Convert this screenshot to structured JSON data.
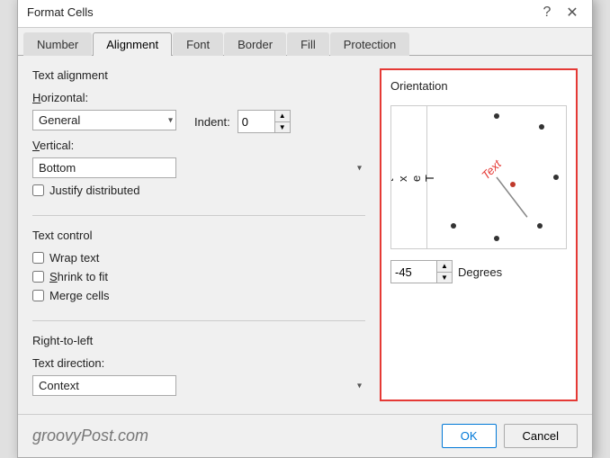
{
  "dialog": {
    "title": "Format Cells",
    "help_btn": "?",
    "close_btn": "✕"
  },
  "tabs": [
    {
      "label": "Number",
      "active": false
    },
    {
      "label": "Alignment",
      "active": true
    },
    {
      "label": "Font",
      "active": false
    },
    {
      "label": "Border",
      "active": false
    },
    {
      "label": "Fill",
      "active": false
    },
    {
      "label": "Protection",
      "active": false
    }
  ],
  "text_alignment": {
    "section_title": "Text alignment",
    "horizontal_label": "Horizontal:",
    "horizontal_value": "General",
    "indent_label": "Indent:",
    "indent_value": "0",
    "vertical_label": "Vertical:",
    "vertical_value": "Bottom",
    "justify_label": "Justify distributed"
  },
  "text_control": {
    "section_title": "Text control",
    "wrap_text": "Wrap text",
    "shrink_to_fit": "Shrink to fit",
    "merge_cells": "Merge cells"
  },
  "right_to_left": {
    "section_title": "Right-to-left",
    "direction_label": "Text direction:",
    "direction_value": "Context"
  },
  "orientation": {
    "title": "Orientation",
    "text_label": "T\ne\nx\nt",
    "dial_text": "Text",
    "degrees_value": "-45",
    "degrees_label": "Degrees"
  },
  "footer": {
    "logo": "groovyPost.com",
    "ok": "OK",
    "cancel": "Cancel"
  }
}
